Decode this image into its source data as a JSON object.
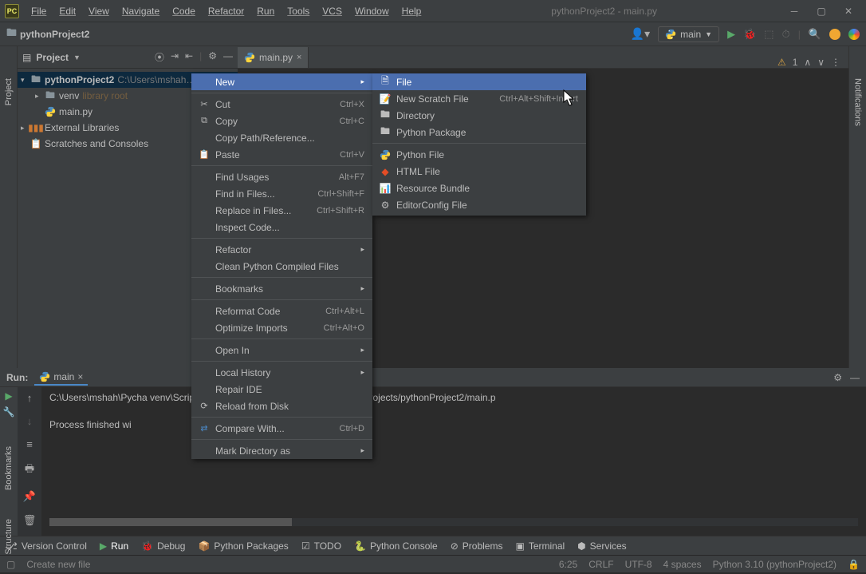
{
  "title": "pythonProject2 - main.py",
  "menubar": [
    "File",
    "Edit",
    "View",
    "Navigate",
    "Code",
    "Refactor",
    "Run",
    "Tools",
    "VCS",
    "Window",
    "Help"
  ],
  "breadcrumb": "pythonProject2",
  "run_config": "main",
  "project_panel": {
    "title": "Project",
    "tree": {
      "root": {
        "name": "pythonProject2",
        "path": "C:\\Users\\mshah…"
      },
      "venv": {
        "name": "venv",
        "tag": "library root"
      },
      "file": "main.py",
      "ext": "External Libraries",
      "scratch": "Scratches and Consoles"
    }
  },
  "tab": {
    "name": "main.py"
  },
  "warn_count": "1",
  "ctx": {
    "new": "New",
    "cut": {
      "l": "Cut",
      "s": "Ctrl+X"
    },
    "copy": {
      "l": "Copy",
      "s": "Ctrl+C"
    },
    "copypath": "Copy Path/Reference...",
    "paste": {
      "l": "Paste",
      "s": "Ctrl+V"
    },
    "findusages": {
      "l": "Find Usages",
      "s": "Alt+F7"
    },
    "findinfiles": {
      "l": "Find in Files...",
      "s": "Ctrl+Shift+F"
    },
    "replaceinfiles": {
      "l": "Replace in Files...",
      "s": "Ctrl+Shift+R"
    },
    "inspect": "Inspect Code...",
    "refactor": "Refactor",
    "cleanpy": "Clean Python Compiled Files",
    "bookmarks": "Bookmarks",
    "reformat": {
      "l": "Reformat Code",
      "s": "Ctrl+Alt+L"
    },
    "optimize": {
      "l": "Optimize Imports",
      "s": "Ctrl+Alt+O"
    },
    "openin": "Open In",
    "localhist": "Local History",
    "repair": "Repair IDE",
    "reload": "Reload from Disk",
    "compare": {
      "l": "Compare With...",
      "s": "Ctrl+D"
    },
    "markdir": "Mark Directory as"
  },
  "sub": {
    "file": "File",
    "scratch": {
      "l": "New Scratch File",
      "s": "Ctrl+Alt+Shift+Insert"
    },
    "dir": "Directory",
    "pkg": "Python Package",
    "pyfile": "Python File",
    "html": "HTML File",
    "resbundle": "Resource Bundle",
    "editorconfig": "EditorConfig File"
  },
  "run_panel": {
    "label": "Run:",
    "tab": "main",
    "line1": "C:\\Users\\mshah\\Pycha                             venv\\Scripts\\python.exe C:/Users/mshah/PycharmProjects/pythonProject2/main.p",
    "line2": "Process finished wi"
  },
  "left_rail": "Project",
  "left_rail2a": "Bookmarks",
  "left_rail2b": "Structure",
  "right_rail": "Notifications",
  "bottom_tools": {
    "vc": "Version Control",
    "run": "Run",
    "debug": "Debug",
    "pypkg": "Python Packages",
    "todo": "TODO",
    "pyconsole": "Python Console",
    "problems": "Problems",
    "terminal": "Terminal",
    "services": "Services"
  },
  "status": {
    "hint": "Create new file",
    "pos": "6:25",
    "le": "CRLF",
    "enc": "UTF-8",
    "indent": "4 spaces",
    "sdk": "Python 3.10 (pythonProject2)"
  }
}
